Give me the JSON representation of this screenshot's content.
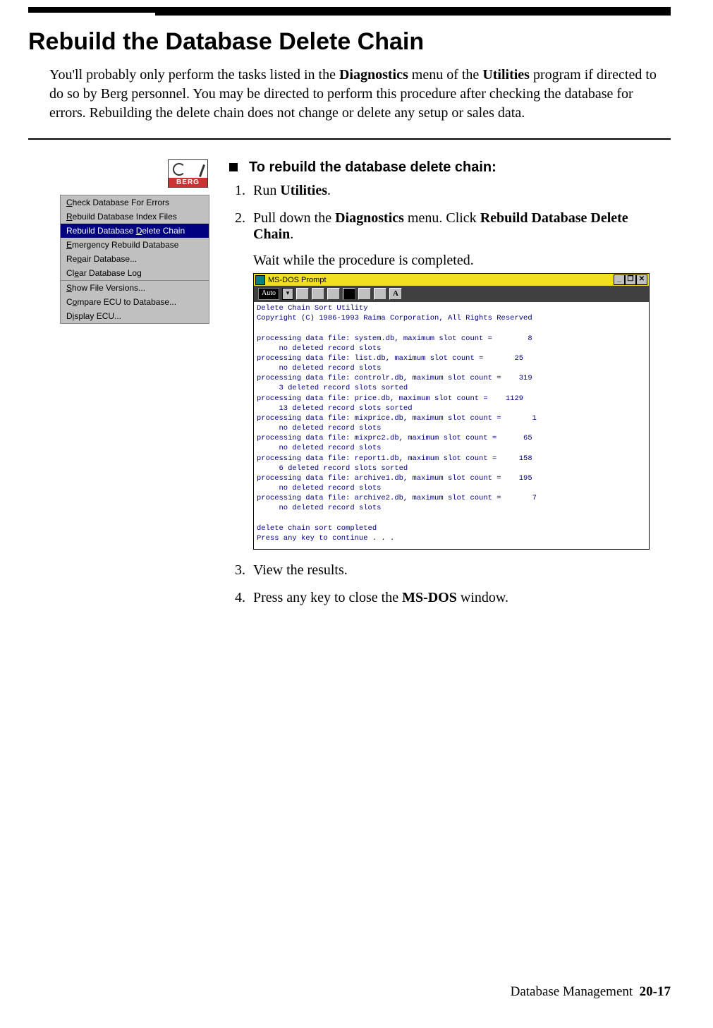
{
  "page": {
    "heading": "Rebuild the Database Delete Chain",
    "intro_parts": {
      "t1": "You'll probably only perform the tasks listed in the ",
      "b1": "Diagnostics",
      "t2": " menu of the ",
      "b2": "Utilities",
      "t3": " program if directed to do so by Berg personnel. You may be directed to perform this procedure after checking the database for errors. Rebuilding the delete chain does not change or delete any setup or sales data."
    },
    "footer_section": "Database Management",
    "footer_page": "20-17"
  },
  "logo": {
    "brand": "BERG"
  },
  "menu": {
    "sections": [
      [
        {
          "u": "C",
          "rest": "heck Database For Errors",
          "sel": false
        },
        {
          "u": "R",
          "rest": "ebuild Database Index Files",
          "sel": false
        },
        {
          "pre": "Rebuild Database ",
          "u": "D",
          "rest": "elete Chain",
          "sel": true
        },
        {
          "u": "E",
          "rest": "mergency Rebuild Database",
          "sel": false
        },
        {
          "pre": "Re",
          "u": "p",
          "rest": "air Database...",
          "sel": false
        },
        {
          "pre": "Cl",
          "u": "e",
          "rest": "ar Database Log",
          "sel": false
        }
      ],
      [
        {
          "u": "S",
          "rest": "how File Versions...",
          "sel": false
        },
        {
          "pre": "C",
          "u": "o",
          "rest": "mpare ECU to Database...",
          "sel": false
        },
        {
          "pre": "D",
          "u": "i",
          "rest": "splay ECU...",
          "sel": false
        }
      ]
    ]
  },
  "task": {
    "title": "To rebuild the database delete chain:",
    "step1": {
      "t1": "Run ",
      "b1": "Utilities",
      "t2": "."
    },
    "step2": {
      "t1": "Pull down the ",
      "b1": "Diagnostics",
      "t2": " menu. Click ",
      "b2": "Rebuild Database Delete Chain",
      "t3": ".",
      "sub": "Wait while the procedure is completed."
    },
    "step3": "View the results.",
    "step4": {
      "t1": "Press any key to close the ",
      "b1": "MS-DOS",
      "t2": " window."
    }
  },
  "dos": {
    "title": "MS-DOS Prompt",
    "btn_min": "_",
    "btn_max": "❐",
    "btn_close": "✕",
    "select_label": "Auto",
    "drop": "▾",
    "toolbar_a": "A",
    "body": "Delete Chain Sort Utility\nCopyright (C) 1986-1993 Raima Corporation, All Rights Reserved\n\nprocessing data file: system.db, maximum slot count =        8\n     no deleted record slots\nprocessing data file: list.db, maximum slot count =       25\n     no deleted record slots\nprocessing data file: controlr.db, maximum slot count =    319\n     3 deleted record slots sorted\nprocessing data file: price.db, maximum slot count =    1129\n     13 deleted record slots sorted\nprocessing data file: mixprice.db, maximum slot count =       1\n     no deleted record slots\nprocessing data file: mixprc2.db, maximum slot count =      65\n     no deleted record slots\nprocessing data file: report1.db, maximum slot count =     158\n     6 deleted record slots sorted\nprocessing data file: archive1.db, maximum slot count =    195\n     no deleted record slots\nprocessing data file: archive2.db, maximum slot count =       7\n     no deleted record slots\n\ndelete chain sort completed\nPress any key to continue . . ."
  }
}
